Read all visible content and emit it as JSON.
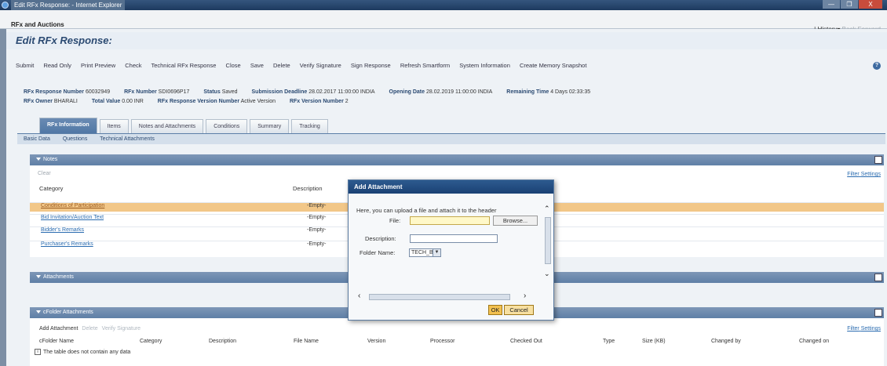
{
  "window": {
    "title": "Edit RFx Response: - Internet Explorer",
    "min": "—",
    "restore": "❐",
    "close": "X"
  },
  "app": {
    "name": "RFx and Auctions",
    "history": "History",
    "back": "Back",
    "forward": "Forward"
  },
  "page": {
    "title": "Edit RFx Response:"
  },
  "toolbar": [
    "Submit",
    "Read Only",
    "Print Preview",
    "Check",
    "Technical RFx Response",
    "Close",
    "Save",
    "Delete",
    "Verify Signature",
    "Sign Response",
    "Refresh Smartform",
    "System Information",
    "Create Memory Snapshot"
  ],
  "header": {
    "row1": [
      {
        "label": "RFx Response Number",
        "value": "60032949"
      },
      {
        "label": "RFx Number",
        "value": "SDI0696P17"
      },
      {
        "label": "Status",
        "value": "Saved"
      },
      {
        "label": "Submission Deadline",
        "value": "28.02.2017 11:00:00 INDIA"
      },
      {
        "label": "Opening Date",
        "value": "28.02.2019 11:00:00 INDIA"
      },
      {
        "label": "Remaining Time",
        "value": "4 Days 02:33:35"
      }
    ],
    "row2": [
      {
        "label": "RFx Owner",
        "value": "BHARALI"
      },
      {
        "label": "Total Value",
        "value": "0.00 INR"
      },
      {
        "label": "RFx Response Version Number",
        "value": "Active Version"
      },
      {
        "label": "RFx Version Number",
        "value": "2"
      }
    ]
  },
  "tabs": [
    "RFx Information",
    "Items",
    "Notes and Attachments",
    "Conditions",
    "Summary",
    "Tracking"
  ],
  "subtabs": [
    "Basic Data",
    "Questions",
    "Technical Attachments"
  ],
  "notes": {
    "title": "Notes",
    "clear": "Clear",
    "filter": "Filter",
    "settings": "Settings",
    "col_category": "Category",
    "col_description": "Description",
    "rows": [
      {
        "category": "Conditions of Participation",
        "description": "-Empty-"
      },
      {
        "category": "Bid Invitation/Auction Text",
        "description": "-Empty-"
      },
      {
        "category": "Bidder's Remarks",
        "description": "-Empty-"
      },
      {
        "category": "Purchaser's Remarks",
        "description": "-Empty-"
      }
    ]
  },
  "attachments": {
    "title": "Attachments"
  },
  "cfolder": {
    "title": "cFolder Attachments",
    "add": "Add Attachment",
    "delete": "Delete",
    "verify": "Verify Signature",
    "filter": "Filter",
    "settings": "Settings",
    "columns": [
      "cFolder Name",
      "Category",
      "Description",
      "File Name",
      "Version",
      "Processor",
      "Checked Out",
      "Type",
      "Size (KB)",
      "Changed by",
      "Changed on"
    ],
    "empty": "The table does not contain any data"
  },
  "dialog": {
    "title": "Add Attachment",
    "intro": "Here, you can upload a file and attach it to the header",
    "file_label": "File:",
    "browse": "Browse...",
    "desc_label": "Description:",
    "folder_label": "Folder Name:",
    "folder_value": "TECH_BI",
    "ok": "OK",
    "cancel": "Cancel"
  }
}
